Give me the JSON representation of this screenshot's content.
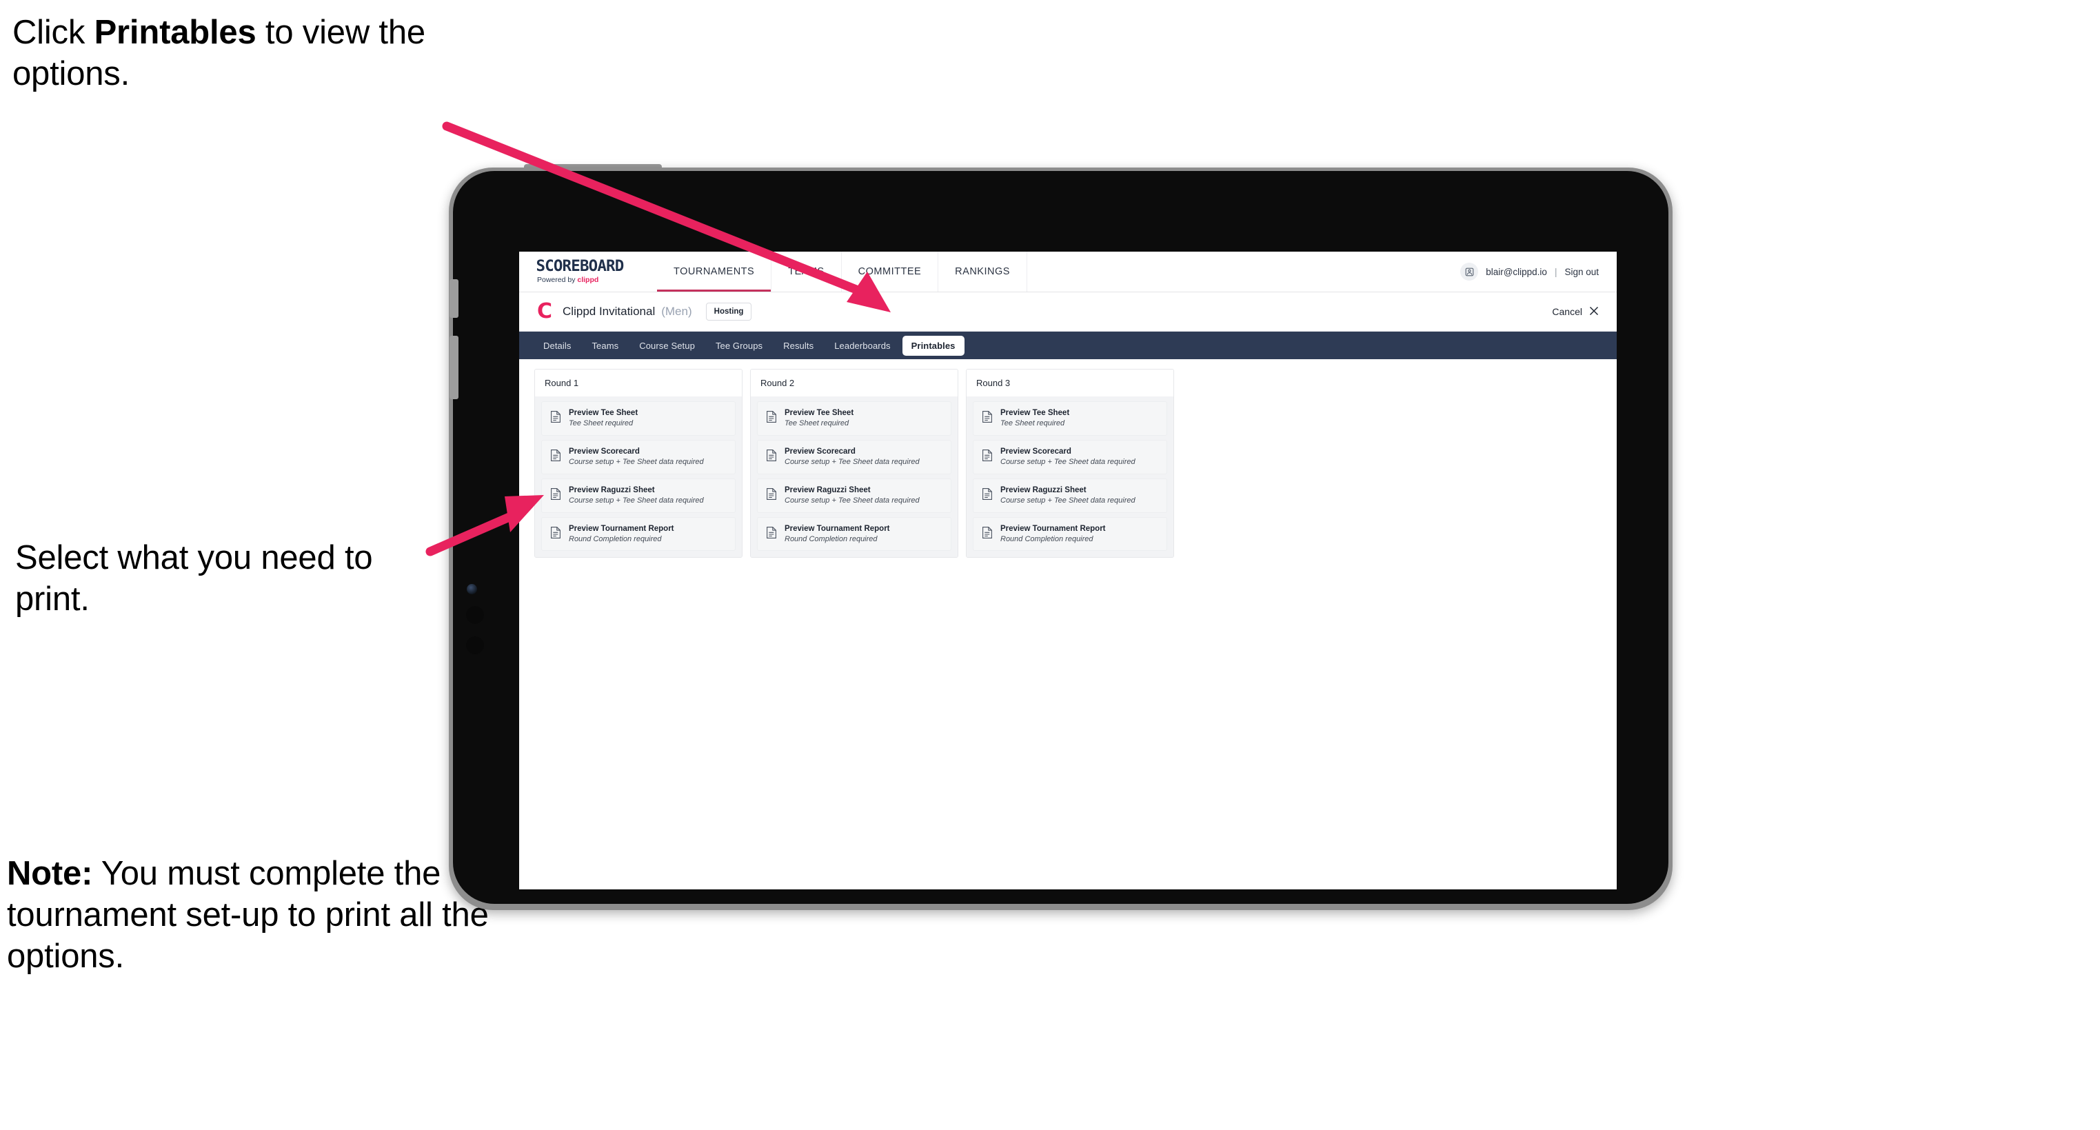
{
  "annotations": {
    "a1_pre": "Click ",
    "a1_bold": "Printables",
    "a1_post": " to view the options.",
    "a2": "Select what you need to print.",
    "a3_bold": "Note:",
    "a3_rest": " You must complete the tournament set-up to print all the options.",
    "arrow_color": "#e8225e"
  },
  "app": {
    "brand": {
      "title": "SCOREBOARD",
      "powered_prefix": "Powered by ",
      "powered_name": "clippd"
    },
    "topnav": {
      "items": [
        {
          "label": "TOURNAMENTS",
          "active": true
        },
        {
          "label": "TEAMS",
          "active": false
        },
        {
          "label": "COMMITTEE",
          "active": false
        },
        {
          "label": "RANKINGS",
          "active": false
        }
      ],
      "user_email": "blair@clippd.io",
      "separator": "|",
      "sign_out": "Sign out",
      "avatar_icon": "user-avatar-icon"
    },
    "tournament_header": {
      "logo_letter": "C",
      "name": "Clippd Invitational",
      "gender": "(Men)",
      "badge": "Hosting",
      "cancel_label": "Cancel",
      "cancel_icon": "close-x-icon"
    },
    "tabs": [
      {
        "label": "Details",
        "active": false
      },
      {
        "label": "Teams",
        "active": false
      },
      {
        "label": "Course Setup",
        "active": false
      },
      {
        "label": "Tee Groups",
        "active": false
      },
      {
        "label": "Results",
        "active": false
      },
      {
        "label": "Leaderboards",
        "active": false
      },
      {
        "label": "Printables",
        "active": true
      }
    ],
    "rounds": [
      {
        "title": "Round 1",
        "items": [
          {
            "title": "Preview Tee Sheet",
            "sub": "Tee Sheet required"
          },
          {
            "title": "Preview Scorecard",
            "sub": "Course setup + Tee Sheet data required"
          },
          {
            "title": "Preview Raguzzi Sheet",
            "sub": "Course setup + Tee Sheet data required"
          },
          {
            "title": "Preview Tournament Report",
            "sub": "Round Completion required"
          }
        ]
      },
      {
        "title": "Round 2",
        "items": [
          {
            "title": "Preview Tee Sheet",
            "sub": "Tee Sheet required"
          },
          {
            "title": "Preview Scorecard",
            "sub": "Course setup + Tee Sheet data required"
          },
          {
            "title": "Preview Raguzzi Sheet",
            "sub": "Course setup + Tee Sheet data required"
          },
          {
            "title": "Preview Tournament Report",
            "sub": "Round Completion required"
          }
        ]
      },
      {
        "title": "Round 3",
        "items": [
          {
            "title": "Preview Tee Sheet",
            "sub": "Tee Sheet required"
          },
          {
            "title": "Preview Scorecard",
            "sub": "Course setup + Tee Sheet data required"
          },
          {
            "title": "Preview Raguzzi Sheet",
            "sub": "Course setup + Tee Sheet data required"
          },
          {
            "title": "Preview Tournament Report",
            "sub": "Round Completion required"
          }
        ]
      }
    ]
  },
  "colors": {
    "accent_pink": "#e8225e",
    "navy": "#2e3b55",
    "text_dark": "#1d2430"
  }
}
